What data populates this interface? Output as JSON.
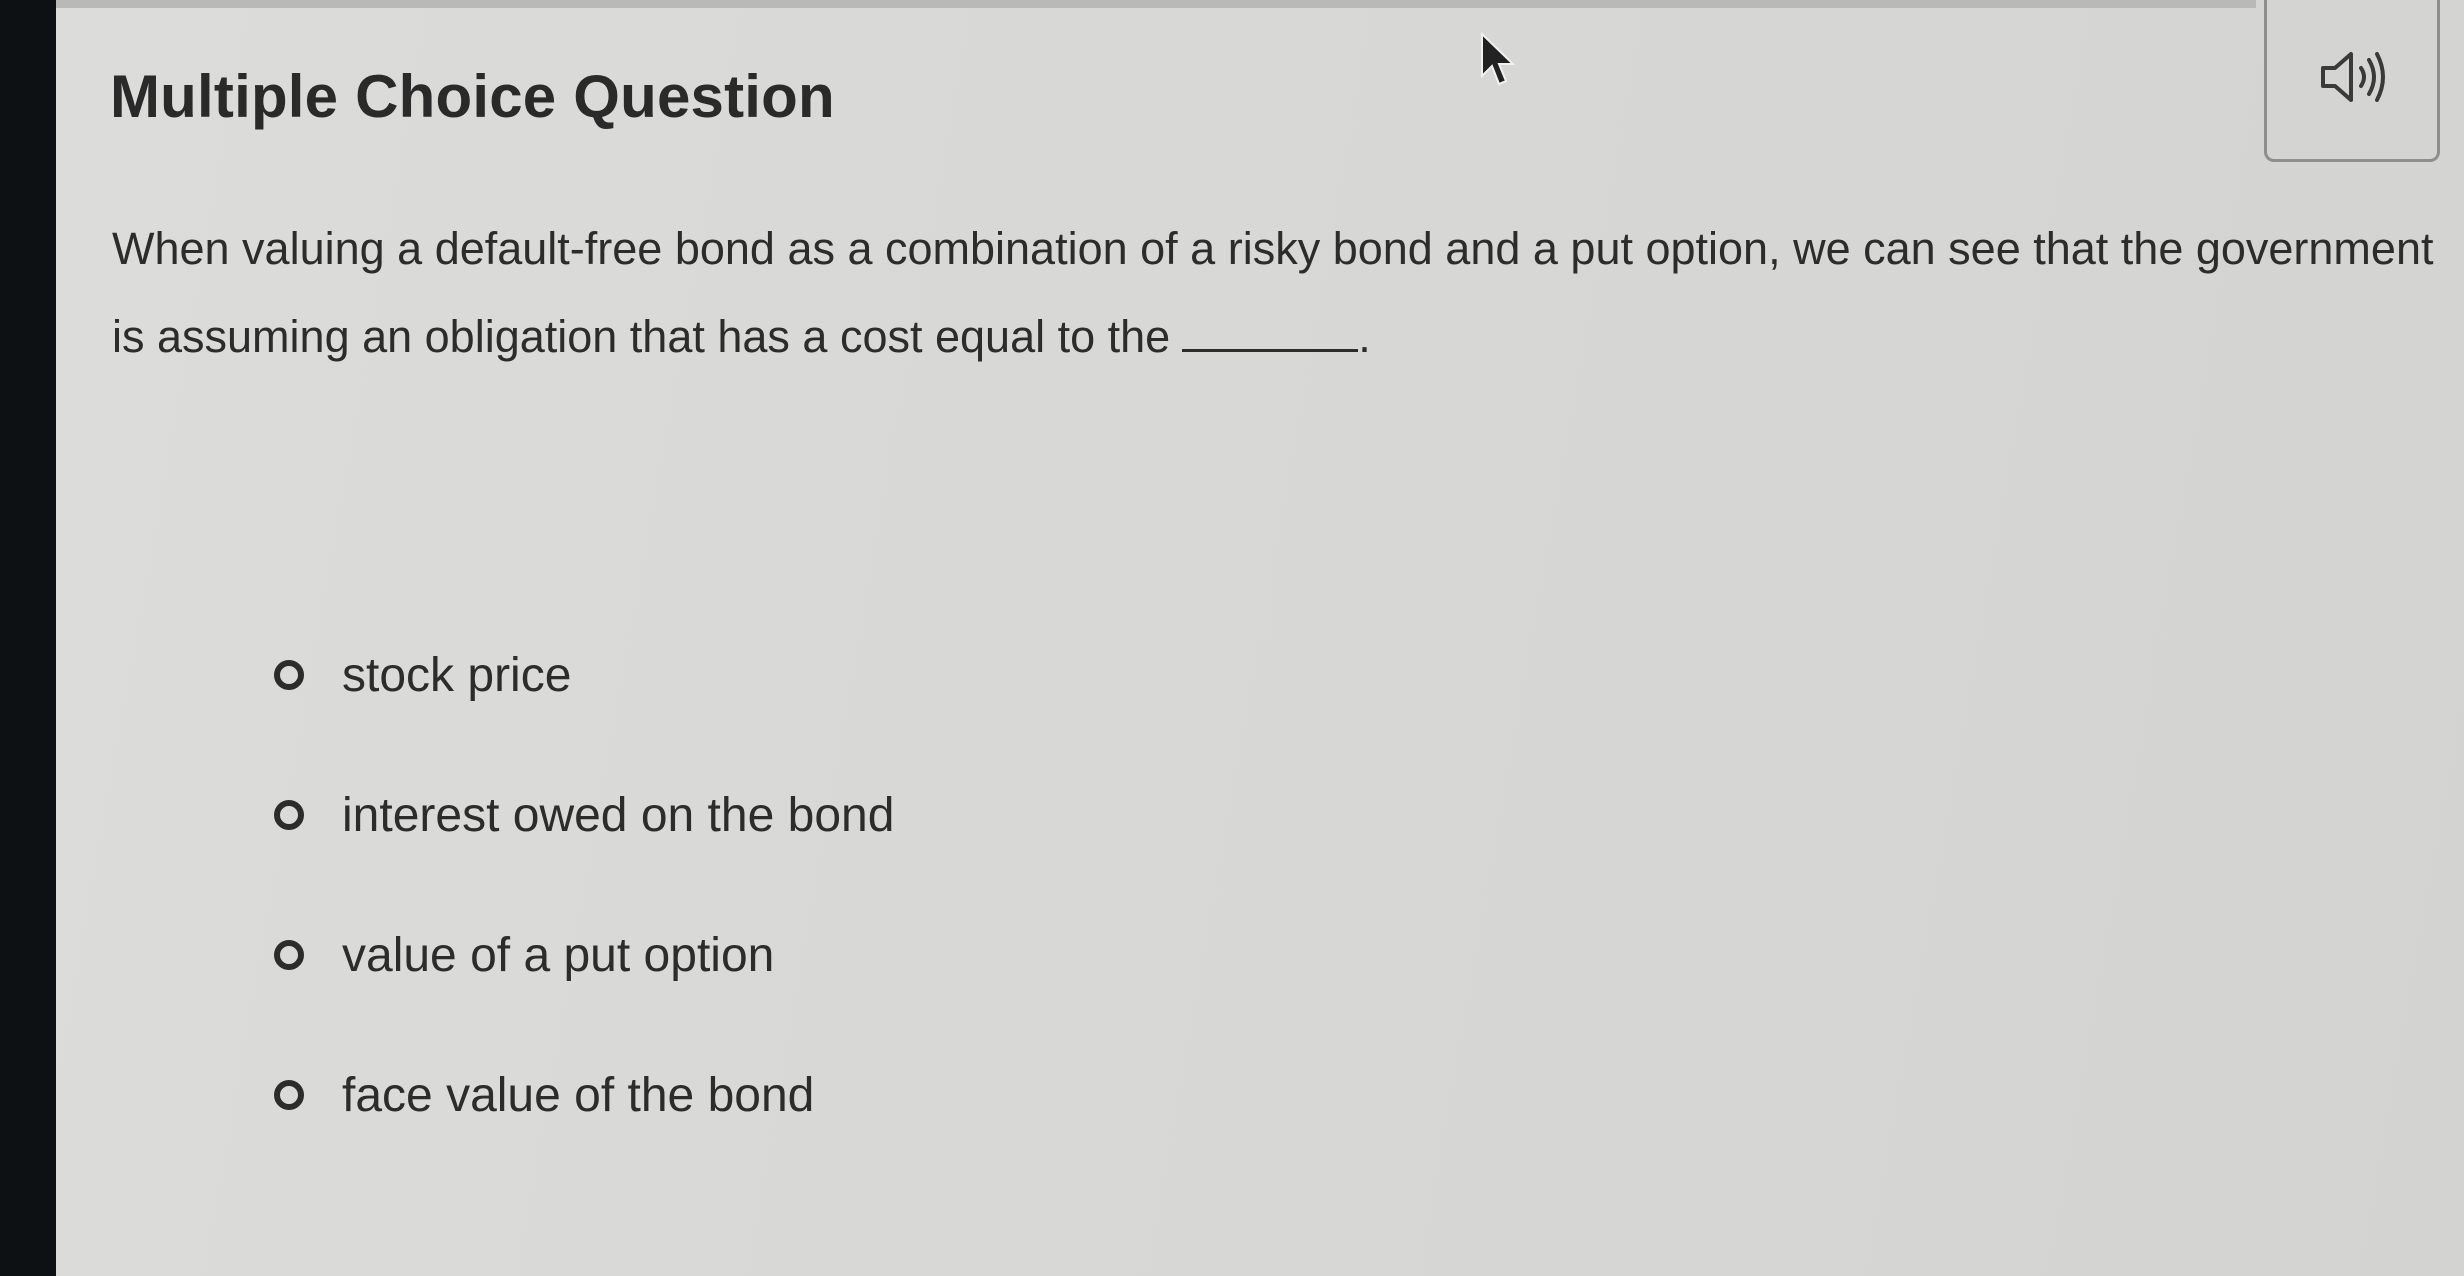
{
  "header": {
    "title": "Multiple Choice Question"
  },
  "audio": {
    "icon": "speaker-icon"
  },
  "question": {
    "text": "When valuing a default-free bond as a combination of a risky bond and a put option, we can see that the government is assuming an obligation that has a cost equal to the",
    "end_punctuation": "."
  },
  "choices": [
    {
      "label": "stock price"
    },
    {
      "label": "interest owed on the bond"
    },
    {
      "label": "value of a put option"
    },
    {
      "label": "face value of the bond"
    }
  ],
  "colors": {
    "background": "#d8d8d6",
    "text": "#2c2c2c"
  }
}
